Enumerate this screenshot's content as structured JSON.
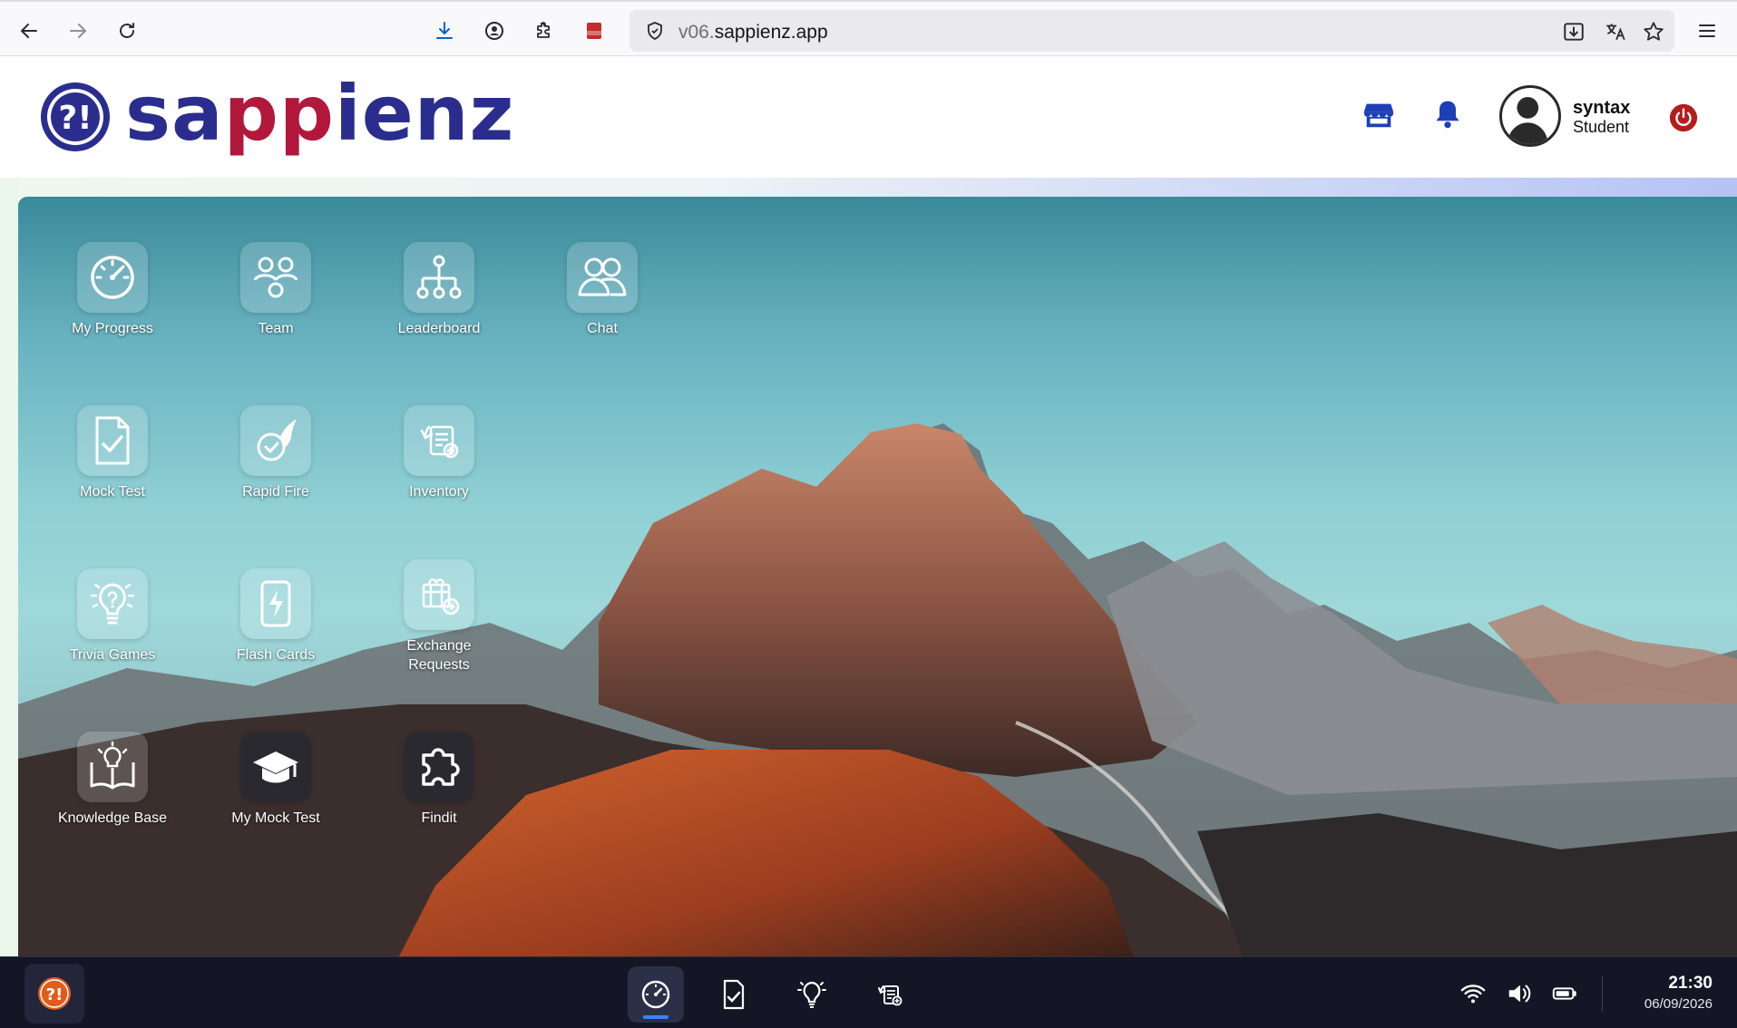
{
  "browser": {
    "url_prefix": "v06.",
    "url_domain": "sappienz.app"
  },
  "header": {
    "logo_text_a": "sa",
    "logo_text_b": "pp",
    "logo_text_c": "ienz",
    "user_name": "syntax",
    "user_role": "Student",
    "icons": [
      "store-icon",
      "bell-icon",
      "avatar",
      "power-icon"
    ]
  },
  "desktop": {
    "apps": [
      {
        "label": "My Progress",
        "icon": "gauge-icon"
      },
      {
        "label": "Team",
        "icon": "team-icon"
      },
      {
        "label": "Leaderboard",
        "icon": "hierarchy-icon"
      },
      {
        "label": "Chat",
        "icon": "people-icon"
      },
      {
        "label": "Mock Test",
        "icon": "checklist-doc-icon"
      },
      {
        "label": "Rapid Fire",
        "icon": "comet-clock-icon"
      },
      {
        "label": "Inventory",
        "icon": "inventory-icon"
      },
      {
        "label": "Trivia Games",
        "icon": "lightbulb-question-icon"
      },
      {
        "label": "Flash Cards",
        "icon": "flash-card-icon"
      },
      {
        "label": "Exchange\nRequests",
        "label_line1": "Exchange",
        "label_line2": "Requests",
        "icon": "exchange-icon"
      },
      {
        "label": "Knowledge Base",
        "icon": "book-bulb-icon"
      },
      {
        "label": "My Mock Test",
        "icon": "graduation-cap-icon"
      },
      {
        "label": "Findit",
        "icon": "puzzle-icon"
      }
    ]
  },
  "taskbar": {
    "time": "21:30",
    "date": "06/09/2026",
    "pinned": [
      "gauge-icon",
      "checklist-doc-icon",
      "lightbulb-question-icon",
      "inventory-icon"
    ],
    "active": "gauge-icon",
    "colors": {
      "accent": "#3b82f6",
      "taskbar_bg": "#141625"
    }
  }
}
